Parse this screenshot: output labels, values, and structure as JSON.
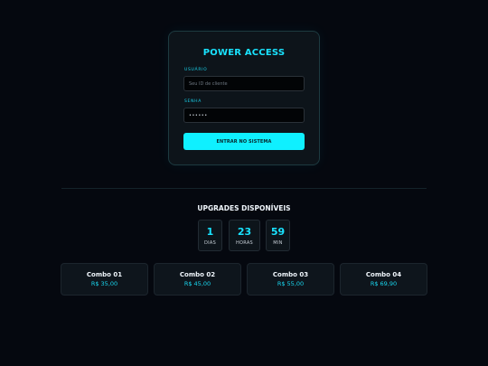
{
  "login": {
    "title": "POWER ACCESS",
    "user_label": "USUÁRIO",
    "user_placeholder": "Seu ID de cliente",
    "pass_label": "SENHA",
    "pass_value": "••••••",
    "submit_label": "ENTRAR NO SISTEMA"
  },
  "upgrades": {
    "title": "UPGRADES DISPONÍVEIS",
    "timer": {
      "days": {
        "value": "1",
        "unit": "DIAS"
      },
      "hours": {
        "value": "23",
        "unit": "HORAS"
      },
      "minutes": {
        "value": "59",
        "unit": "MIN"
      }
    },
    "combos": [
      {
        "name": "Combo 01",
        "price": "R$ 35,00"
      },
      {
        "name": "Combo 02",
        "price": "R$ 45,00"
      },
      {
        "name": "Combo 03",
        "price": "R$ 55,00"
      },
      {
        "name": "Combo 04",
        "price": "R$ 69,90"
      }
    ]
  },
  "colors": {
    "background": "#05080f",
    "accent": "#0ff0ff",
    "card": "#0d141a"
  }
}
